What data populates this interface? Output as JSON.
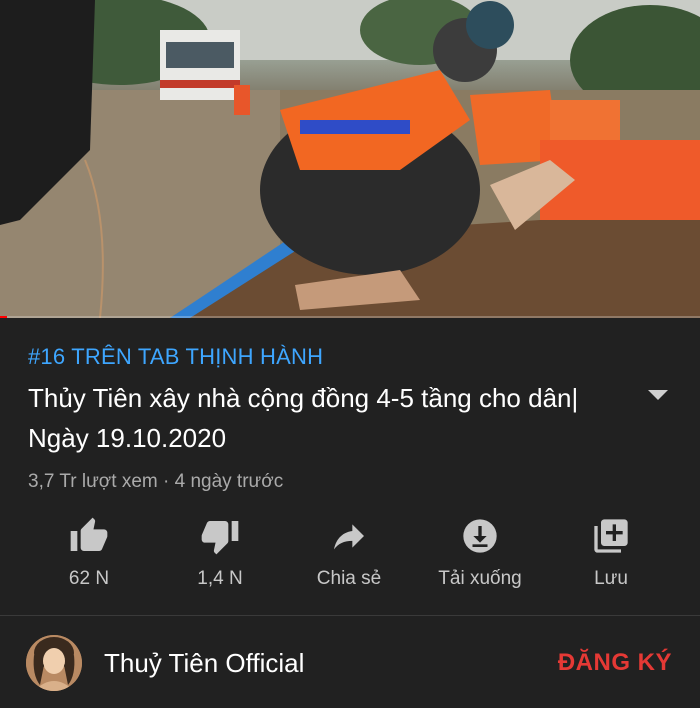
{
  "video": {
    "progress_fraction": 0.01
  },
  "trending_tag": "#16 TRÊN TAB THỊNH HÀNH",
  "title": "Thủy Tiên xây nhà cộng đồng 4-5 tầng cho dân| Ngày 19.10.2020",
  "stats": {
    "views": "3,7 Tr lượt xem",
    "separator": " · ",
    "uploaded": "4 ngày trước"
  },
  "actions": [
    {
      "icon": "thumbs-up-icon",
      "label": "62 N"
    },
    {
      "icon": "thumbs-down-icon",
      "label": "1,4 N"
    },
    {
      "icon": "share-icon",
      "label": "Chia sẻ"
    },
    {
      "icon": "download-icon",
      "label": "Tải xuống"
    },
    {
      "icon": "save-to-playlist-icon",
      "label": "Lưu"
    }
  ],
  "channel": {
    "name": "Thuỷ Tiên Official",
    "subscribe_label": "ĐĂNG KÝ"
  },
  "colors": {
    "background": "#212121",
    "hashtag": "#3ea6ff",
    "subscribe": "#e53935",
    "progress": "#ff0000"
  }
}
